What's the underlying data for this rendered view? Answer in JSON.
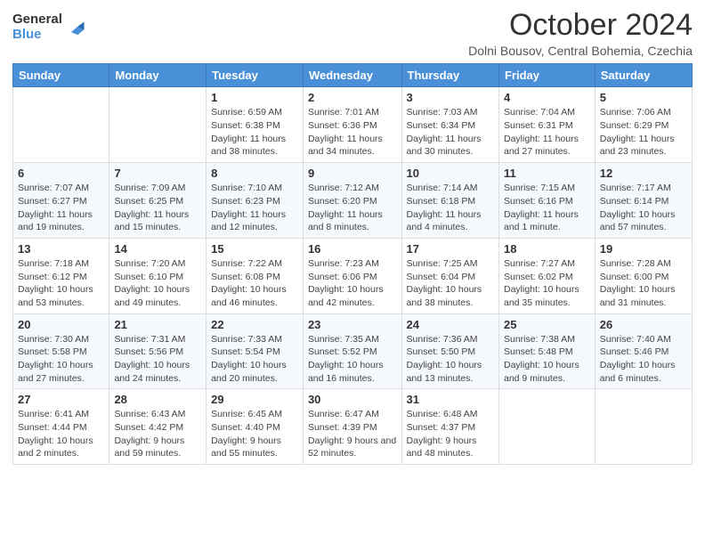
{
  "logo": {
    "general": "General",
    "blue": "Blue"
  },
  "header": {
    "month": "October 2024",
    "location": "Dolni Bousov, Central Bohemia, Czechia"
  },
  "weekdays": [
    "Sunday",
    "Monday",
    "Tuesday",
    "Wednesday",
    "Thursday",
    "Friday",
    "Saturday"
  ],
  "weeks": [
    [
      {
        "day": "",
        "info": ""
      },
      {
        "day": "",
        "info": ""
      },
      {
        "day": "1",
        "info": "Sunrise: 6:59 AM\nSunset: 6:38 PM\nDaylight: 11 hours and 38 minutes."
      },
      {
        "day": "2",
        "info": "Sunrise: 7:01 AM\nSunset: 6:36 PM\nDaylight: 11 hours and 34 minutes."
      },
      {
        "day": "3",
        "info": "Sunrise: 7:03 AM\nSunset: 6:34 PM\nDaylight: 11 hours and 30 minutes."
      },
      {
        "day": "4",
        "info": "Sunrise: 7:04 AM\nSunset: 6:31 PM\nDaylight: 11 hours and 27 minutes."
      },
      {
        "day": "5",
        "info": "Sunrise: 7:06 AM\nSunset: 6:29 PM\nDaylight: 11 hours and 23 minutes."
      }
    ],
    [
      {
        "day": "6",
        "info": "Sunrise: 7:07 AM\nSunset: 6:27 PM\nDaylight: 11 hours and 19 minutes."
      },
      {
        "day": "7",
        "info": "Sunrise: 7:09 AM\nSunset: 6:25 PM\nDaylight: 11 hours and 15 minutes."
      },
      {
        "day": "8",
        "info": "Sunrise: 7:10 AM\nSunset: 6:23 PM\nDaylight: 11 hours and 12 minutes."
      },
      {
        "day": "9",
        "info": "Sunrise: 7:12 AM\nSunset: 6:20 PM\nDaylight: 11 hours and 8 minutes."
      },
      {
        "day": "10",
        "info": "Sunrise: 7:14 AM\nSunset: 6:18 PM\nDaylight: 11 hours and 4 minutes."
      },
      {
        "day": "11",
        "info": "Sunrise: 7:15 AM\nSunset: 6:16 PM\nDaylight: 11 hours and 1 minute."
      },
      {
        "day": "12",
        "info": "Sunrise: 7:17 AM\nSunset: 6:14 PM\nDaylight: 10 hours and 57 minutes."
      }
    ],
    [
      {
        "day": "13",
        "info": "Sunrise: 7:18 AM\nSunset: 6:12 PM\nDaylight: 10 hours and 53 minutes."
      },
      {
        "day": "14",
        "info": "Sunrise: 7:20 AM\nSunset: 6:10 PM\nDaylight: 10 hours and 49 minutes."
      },
      {
        "day": "15",
        "info": "Sunrise: 7:22 AM\nSunset: 6:08 PM\nDaylight: 10 hours and 46 minutes."
      },
      {
        "day": "16",
        "info": "Sunrise: 7:23 AM\nSunset: 6:06 PM\nDaylight: 10 hours and 42 minutes."
      },
      {
        "day": "17",
        "info": "Sunrise: 7:25 AM\nSunset: 6:04 PM\nDaylight: 10 hours and 38 minutes."
      },
      {
        "day": "18",
        "info": "Sunrise: 7:27 AM\nSunset: 6:02 PM\nDaylight: 10 hours and 35 minutes."
      },
      {
        "day": "19",
        "info": "Sunrise: 7:28 AM\nSunset: 6:00 PM\nDaylight: 10 hours and 31 minutes."
      }
    ],
    [
      {
        "day": "20",
        "info": "Sunrise: 7:30 AM\nSunset: 5:58 PM\nDaylight: 10 hours and 27 minutes."
      },
      {
        "day": "21",
        "info": "Sunrise: 7:31 AM\nSunset: 5:56 PM\nDaylight: 10 hours and 24 minutes."
      },
      {
        "day": "22",
        "info": "Sunrise: 7:33 AM\nSunset: 5:54 PM\nDaylight: 10 hours and 20 minutes."
      },
      {
        "day": "23",
        "info": "Sunrise: 7:35 AM\nSunset: 5:52 PM\nDaylight: 10 hours and 16 minutes."
      },
      {
        "day": "24",
        "info": "Sunrise: 7:36 AM\nSunset: 5:50 PM\nDaylight: 10 hours and 13 minutes."
      },
      {
        "day": "25",
        "info": "Sunrise: 7:38 AM\nSunset: 5:48 PM\nDaylight: 10 hours and 9 minutes."
      },
      {
        "day": "26",
        "info": "Sunrise: 7:40 AM\nSunset: 5:46 PM\nDaylight: 10 hours and 6 minutes."
      }
    ],
    [
      {
        "day": "27",
        "info": "Sunrise: 6:41 AM\nSunset: 4:44 PM\nDaylight: 10 hours and 2 minutes."
      },
      {
        "day": "28",
        "info": "Sunrise: 6:43 AM\nSunset: 4:42 PM\nDaylight: 9 hours and 59 minutes."
      },
      {
        "day": "29",
        "info": "Sunrise: 6:45 AM\nSunset: 4:40 PM\nDaylight: 9 hours and 55 minutes."
      },
      {
        "day": "30",
        "info": "Sunrise: 6:47 AM\nSunset: 4:39 PM\nDaylight: 9 hours and 52 minutes."
      },
      {
        "day": "31",
        "info": "Sunrise: 6:48 AM\nSunset: 4:37 PM\nDaylight: 9 hours and 48 minutes."
      },
      {
        "day": "",
        "info": ""
      },
      {
        "day": "",
        "info": ""
      }
    ]
  ]
}
